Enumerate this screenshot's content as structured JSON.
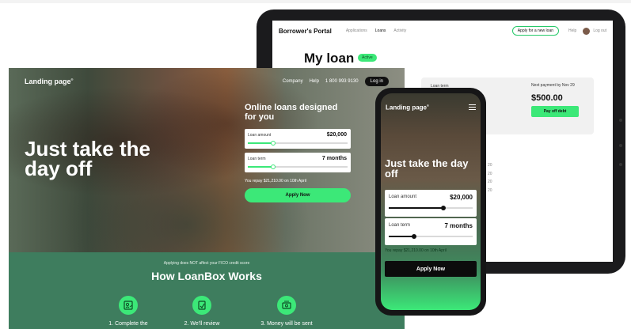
{
  "tablet": {
    "nav": {
      "logo": "Borrower's Portal",
      "links": [
        "Applications",
        "Loans",
        "Activity"
      ],
      "apply_button": "Apply for a new loan",
      "help": "Help",
      "logout": "Log out"
    },
    "title": "My loan",
    "status_badge": "Active",
    "loan_term_label": "Loan term",
    "next_payment_label": "Next payment by Nov 29",
    "next_payment_amount": "$500.00",
    "pay_button": "Pay off debt",
    "partial_numbers": [
      "20",
      "20",
      "20",
      "20"
    ]
  },
  "landing": {
    "nav": {
      "logo": "Landing page",
      "logo_mark": "®",
      "links": [
        "Company",
        "Help"
      ],
      "phone": "1 800 993 9130",
      "login": "Log in"
    },
    "headline": "Just take the day off",
    "form_title": "Online loans designed for you",
    "loan_amount": {
      "label": "Loan amount",
      "value": "$20,000",
      "level": 0.25
    },
    "loan_term": {
      "label": "Loan term",
      "value": "7 months",
      "level": 0.25
    },
    "repay_text": "You repay $21,210.00 on 10th April",
    "apply_button": "Apply Now",
    "fico_note": "Applying does NOT affect your FICO credit score",
    "how_title": "How LoanBox Works",
    "steps": [
      "1. Complete the",
      "2. We'll review",
      "3. Money will be sent"
    ]
  },
  "phone": {
    "logo": "Landing page",
    "logo_mark": "®",
    "headline": "Just take the day off",
    "loan_amount": {
      "label": "Loan amount",
      "value": "$20,000",
      "level": 0.65
    },
    "loan_term": {
      "label": "Loan term",
      "value": "7 months",
      "level": 0.3
    },
    "repay_text": "You repay $21,210.00 on 10th April",
    "apply_button": "Apply Now"
  },
  "colors": {
    "accent": "#3ce878",
    "section_green": "#3e7d5e",
    "dark": "#111111"
  }
}
